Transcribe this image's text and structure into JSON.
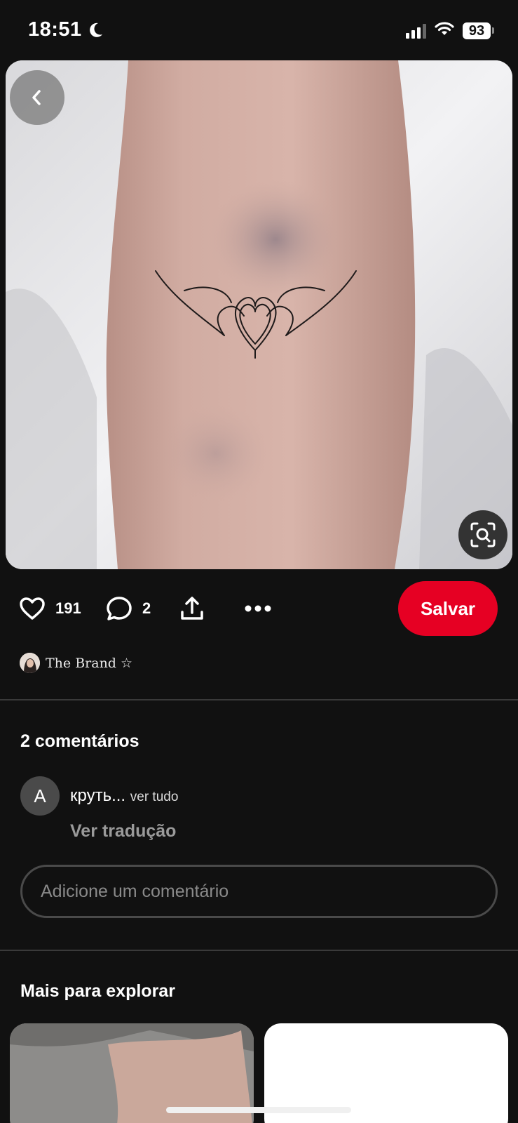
{
  "status_bar": {
    "time": "18:51",
    "battery": "93",
    "icons": [
      "moon-icon",
      "signal-icon",
      "wifi-icon",
      "battery-icon"
    ]
  },
  "pin": {
    "image_icons": [
      "back-arrow-icon",
      "visual-search-icon"
    ],
    "reactions_count": "191",
    "comments_count": "2",
    "save_label": "Salvar",
    "creator_name": "The Brand ☆"
  },
  "comments": {
    "title": "2 comentários",
    "items": [
      {
        "avatar_letter": "A",
        "text": "круть...",
        "more_label": "ver tudo",
        "translate_label": "Ver tradução"
      }
    ],
    "input_placeholder": "Adicione um comentário"
  },
  "explore": {
    "title": "Mais para explorar"
  },
  "colors": {
    "background": "#111111",
    "save_button": "#e60023",
    "muted_text": "#9a9a9a"
  }
}
